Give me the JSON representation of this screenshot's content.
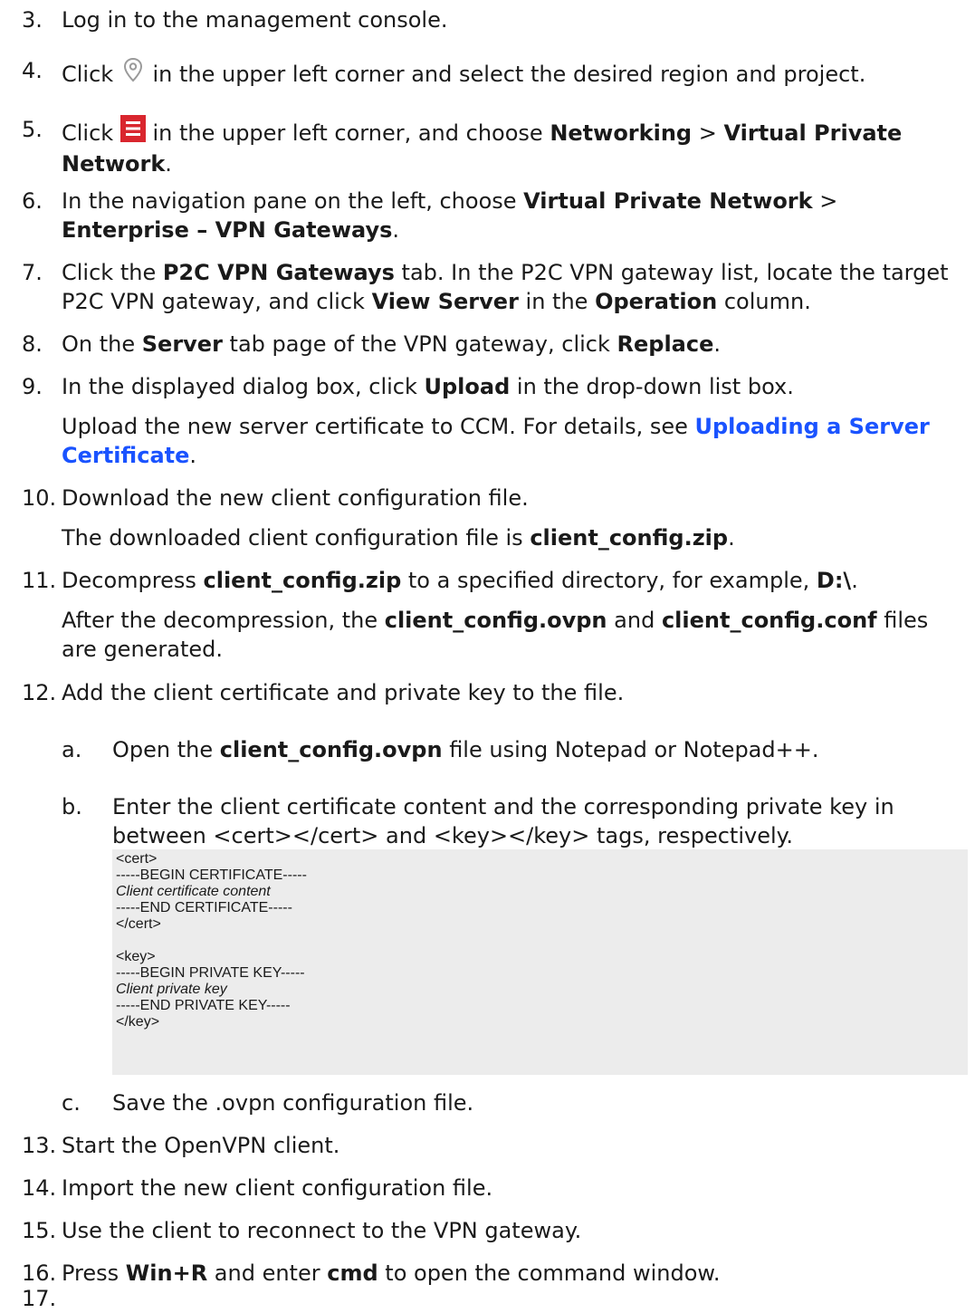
{
  "steps": [
    {
      "num": "3.",
      "text": "Log in to the management console."
    },
    {
      "num": "4.",
      "pre": "Click ",
      "icon": "location-pin-icon",
      "post": " in the upper left corner and select the desired region and project."
    },
    {
      "num": "5.",
      "pre": "Click ",
      "icon": "menu-hamburger-icon",
      "post": " in the upper left corner, and choose ",
      "b1": "Networking",
      "sep": " > ",
      "b2": "Virtual Private Network",
      "end": "."
    },
    {
      "num": "6.",
      "pre": "In the navigation pane on the left, choose ",
      "b1": "Virtual Private Network",
      "sep": " > ",
      "b2": "Enterprise – VPN Gateways",
      "end": "."
    },
    {
      "num": "7.",
      "pre": "Click the ",
      "b1": "P2C VPN Gateways",
      "mid1": " tab. In the P2C VPN gateway list, locate the target P2C VPN gateway, and click ",
      "b2": "View Server",
      "mid2": " in the ",
      "b3": "Operation",
      "end": " column."
    },
    {
      "num": "8.",
      "pre": "On the ",
      "b1": "Server",
      "mid1": " tab page of the VPN gateway, click ",
      "b2": "Replace",
      "end": "."
    },
    {
      "num": "9.",
      "pre": "In the displayed dialog box, click ",
      "b1": "Upload",
      "end": " in the drop-down list box.",
      "para_pre": "Upload the new server certificate to CCM. For details, see ",
      "para_link": "Uploading a Server Certificate",
      "para_end": "."
    },
    {
      "num": "10.",
      "text": "Download the new client configuration file.",
      "para_pre": "The downloaded client configuration file is ",
      "para_b": "client_config.zip",
      "para_end": "."
    },
    {
      "num": "11.",
      "pre": "Decompress ",
      "b1": "client_config.zip",
      "mid1": " to a specified directory, for example, ",
      "b2": "D:\\",
      "end": ".",
      "para_pre": "After the decompression, the ",
      "para_b1": "client_config.ovpn",
      "para_mid": " and ",
      "para_b2": "client_config.conf",
      "para_end": " files are generated."
    },
    {
      "num": "12.",
      "text": "Add the client certificate and private key to the file."
    },
    {
      "num": "13.",
      "text": "Start the OpenVPN client."
    },
    {
      "num": "14.",
      "text": "Import the new client configuration file."
    },
    {
      "num": "15.",
      "text": "Use the client to reconnect to the VPN gateway."
    },
    {
      "num": "16.",
      "pre": "Press ",
      "b1": "Win+R",
      "mid1": " and enter ",
      "b2": "cmd",
      "end": " to open the command window."
    },
    {
      "num": "17.",
      "text": ""
    }
  ],
  "substeps": [
    {
      "num": "a.",
      "pre": "Open the ",
      "b1": "client_config.ovpn",
      "end": " file using Notepad or Notepad++."
    },
    {
      "num": "b.",
      "text": "Enter the client certificate content and the corresponding private key in between <cert></cert> and <key></key> tags, respectively."
    },
    {
      "num": "c.",
      "text": "Save the .ovpn configuration file."
    }
  ],
  "code_lines": [
    "<cert>",
    "-----BEGIN CERTIFICATE-----",
    "Client certificate content",
    "-----END CERTIFICATE-----",
    "</cert>",
    "",
    "<key>",
    "-----BEGIN PRIVATE KEY-----",
    "Client private key",
    "-----END PRIVATE KEY-----",
    "</key>"
  ],
  "colors": {
    "link": "#1a53ff",
    "menu_icon": "#d9262e",
    "pin_icon": "#9a9a9a",
    "code_bg": "#ececec"
  }
}
